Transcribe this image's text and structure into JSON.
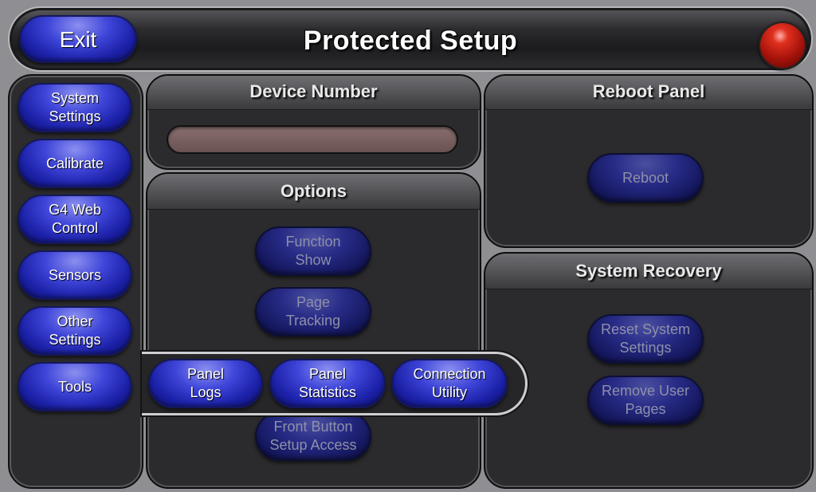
{
  "header": {
    "exit_label": "Exit",
    "title": "Protected Setup",
    "status_led_color": "#c0190e"
  },
  "sidebar": {
    "items": [
      {
        "label": "System\nSettings"
      },
      {
        "label": "Calibrate"
      },
      {
        "label": "G4 Web\nControl"
      },
      {
        "label": "Sensors"
      },
      {
        "label": "Other\nSettings"
      },
      {
        "label": "Tools"
      }
    ]
  },
  "device_number": {
    "title": "Device Number",
    "value": ""
  },
  "options": {
    "title": "Options",
    "buttons": [
      {
        "label": "Function\nShow"
      },
      {
        "label": "Page\nTracking"
      },
      {
        "label": "Front Button\nSetup Access"
      }
    ]
  },
  "reboot": {
    "title": "Reboot Panel",
    "button_label": "Reboot"
  },
  "recovery": {
    "title": "System Recovery",
    "buttons": [
      {
        "label": "Reset System\nSettings"
      },
      {
        "label": "Remove User\nPages"
      }
    ]
  },
  "tools_popup": {
    "buttons": [
      {
        "label": "Panel\nLogs"
      },
      {
        "label": "Panel\nStatistics"
      },
      {
        "label": "Connection\nUtility"
      }
    ]
  },
  "colors": {
    "button_blue": "#2a31c8",
    "panel_bg": "#2b2b2d",
    "screen_bg": "#8f8f93"
  }
}
